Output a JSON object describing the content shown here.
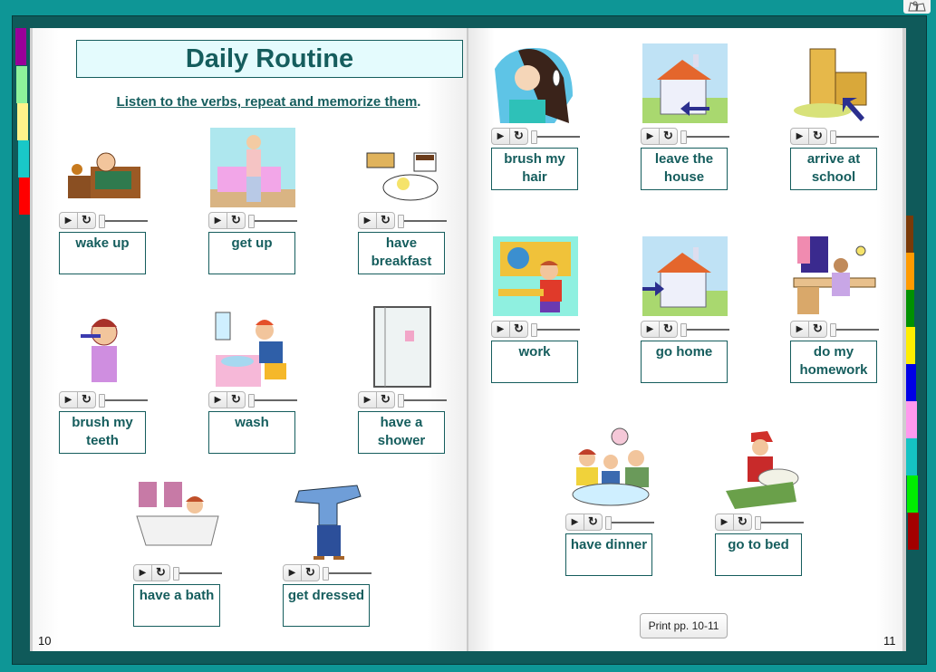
{
  "header": {
    "title": "Daily Routine",
    "instruction": "Listen to the verbs, repeat and memorize them",
    "instruction_period": "."
  },
  "controls": {
    "play_icon": "▶",
    "replay_icon": "↻",
    "slider_progress": 0
  },
  "left_page": {
    "page_number": "10",
    "items": [
      {
        "label": "wake up",
        "image": "girl-in-bed-alarm-clock"
      },
      {
        "label": "get up",
        "image": "boy-stretching-by-bed"
      },
      {
        "label": "have breakfast",
        "image": "breakfast-toast-eggs-coffee"
      },
      {
        "label": "brush my teeth",
        "image": "girl-brushing-teeth"
      },
      {
        "label": "wash",
        "image": "woman-washing-at-sink"
      },
      {
        "label": "have a shower",
        "image": "shower-cabin"
      },
      {
        "label": "have a bath",
        "image": "woman-in-bathtub"
      },
      {
        "label": "get dressed",
        "image": "boy-putting-on-sweater"
      }
    ]
  },
  "right_page": {
    "page_number": "11",
    "items": [
      {
        "label": "brush my hair",
        "image": "woman-brushing-hair"
      },
      {
        "label": "leave the house",
        "image": "house-arrow-out"
      },
      {
        "label": "arrive at school",
        "image": "school-arrow-in"
      },
      {
        "label": "work",
        "image": "boy-writing-at-desk"
      },
      {
        "label": "go home",
        "image": "house-arrow-in"
      },
      {
        "label": "do my homework",
        "image": "girl-at-desk-lamp"
      },
      {
        "label": "have dinner",
        "image": "family-at-dinner-table"
      },
      {
        "label": "go to bed",
        "image": "boy-with-nightcap-bed"
      }
    ],
    "print_button": "Print pp. 10-11"
  },
  "tabs": {
    "left": [
      "#990099",
      "#8df29b",
      "#fff38a",
      "#19c8c8",
      "#ff0000"
    ],
    "right": [
      "#7a3a08",
      "#ff9a00",
      "#009100",
      "#ffee00",
      "#0000e6",
      "#ff99ee",
      "#15c3c3",
      "#00ee00",
      "#a30000"
    ]
  },
  "colors": {
    "accent": "#155d5d",
    "background": "#0e9696",
    "book_cover": "#0f5a5a"
  }
}
